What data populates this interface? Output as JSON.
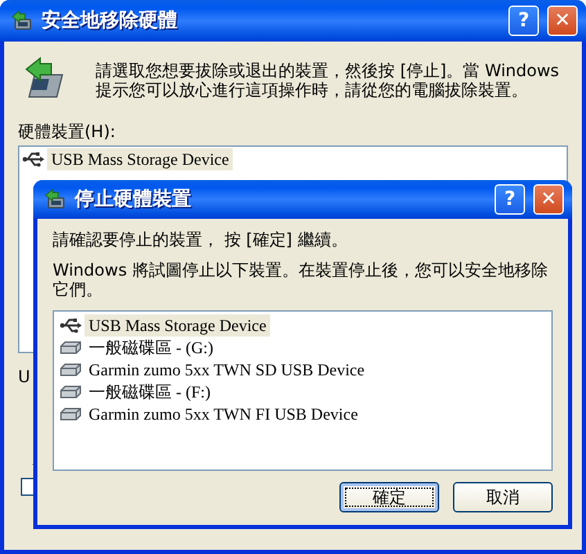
{
  "main_window": {
    "title": "安全地移除硬體",
    "title_buttons": [
      {
        "kind": "help",
        "label": "?"
      },
      {
        "kind": "close",
        "label": "✕"
      }
    ],
    "instructions": "請選取您想要拔除或退出的裝置，然後按 [停止]。當 Windows 提示您可以放心進行這項操作時，請從您的電腦拔除裝置。",
    "list_label": "硬體裝置(H):",
    "devices": [
      {
        "name": "USB Mass Storage Device",
        "selected": true
      }
    ],
    "partial_label": "U"
  },
  "dialog": {
    "title": "停止硬體裝置",
    "title_buttons": [
      {
        "kind": "help",
        "label": "?"
      },
      {
        "kind": "close",
        "label": "✕"
      }
    ],
    "prompt": "請確認要停止的裝置， 按 [確定] 繼續。",
    "message": "Windows 將試圖停止以下裝置。在裝置停止後，您可以安全地移除它們。",
    "devices": [
      {
        "name": "USB Mass Storage Device",
        "kind": "usb",
        "selected": true
      },
      {
        "name": "一般磁碟區 - (G:)",
        "kind": "drive",
        "selected": false
      },
      {
        "name": "Garmin zumo 5xx TWN SD USB Device",
        "kind": "drive",
        "selected": false
      },
      {
        "name": "一般磁碟區 - (F:)",
        "kind": "drive",
        "selected": false
      },
      {
        "name": "Garmin zumo 5xx TWN FI USB Device",
        "kind": "drive",
        "selected": false
      }
    ],
    "buttons": [
      {
        "label": "確定",
        "default": true
      },
      {
        "label": "取消",
        "default": false
      }
    ]
  }
}
